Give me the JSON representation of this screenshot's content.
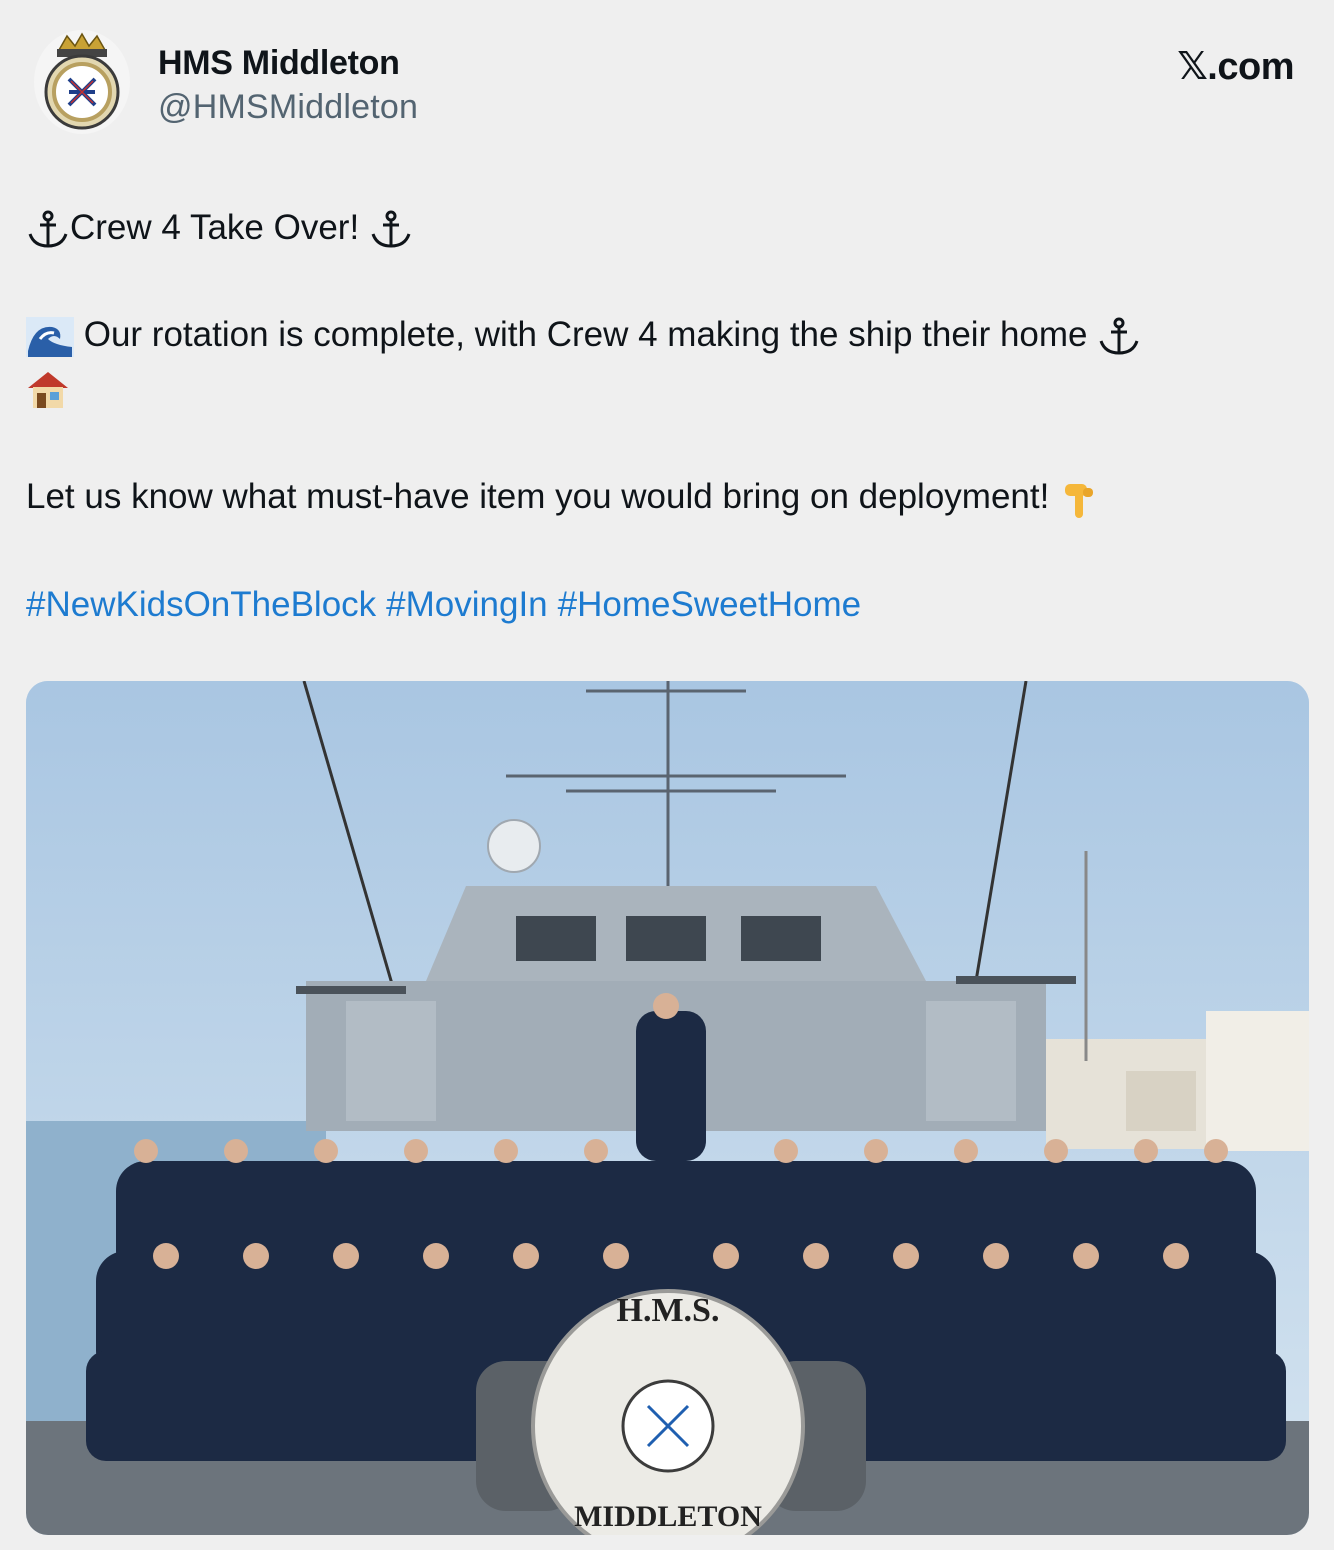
{
  "author": {
    "display_name": "HMS Middleton",
    "handle": "@HMSMiddleton",
    "avatar_icon": "ship-crest-icon"
  },
  "site": {
    "brand": "𝕏.com"
  },
  "post": {
    "line1": {
      "text": "Crew 4 Take Over!",
      "lead_icon": "anchor-icon",
      "trail_icon": "anchor-icon"
    },
    "line2": {
      "text": "Our rotation is complete, with Crew 4 making the ship their home",
      "lead_icon": "wave-icon",
      "trail_icons": [
        "anchor-icon",
        "house-icon"
      ]
    },
    "line3": {
      "text": "Let us know what must-have item you would bring on deployment!",
      "trail_icon": "pointing-down-icon"
    },
    "hashtags": [
      "#NewKidsOnTheBlock",
      "#MovingIn",
      "#HomeSweetHome"
    ]
  },
  "media": {
    "bollard_top": "H.M.S.",
    "bollard_bottom": "MIDDLETON",
    "colors": {
      "sky": "#b9d2e8",
      "hull": "#9aa6b1",
      "uniform": "#1c2a44"
    }
  }
}
